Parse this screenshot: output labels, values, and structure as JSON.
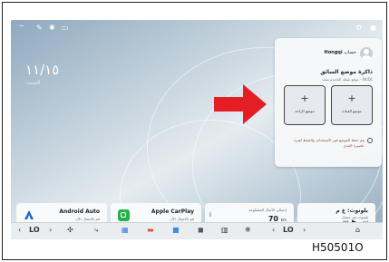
{
  "statusbar": {
    "icons": [
      "wifi-icon",
      "bluetooth-icon",
      "camera-icon",
      "settings-icon"
    ]
  },
  "date": {
    "main": "١١/١٥",
    "sub": "السبت"
  },
  "panel": {
    "account_name": "Hongqi",
    "account_prefix": "حساب",
    "title": "ذاكرة موضع السائق",
    "subtitle": "موقع نقطة القاعدة مقعد - NUDL",
    "slot_right_label": "موضع القيادة",
    "slot_left_label": "موضع الراحة",
    "plus_symbol": "+",
    "notice": "يتم حفظ الموضع فور الاستخدام، والحفظ لفترة قصيرة المدى."
  },
  "cards": {
    "android_title": "Android Auto",
    "android_sub": "قم بالاتصال الآن",
    "carplay_title": "Apple CarPlay",
    "carplay_sub": "قم بالاتصال الآن",
    "trip_title": "إجمالي الأميال المقطوعة",
    "trip_unit": "km",
    "trip_value": "70",
    "bt_title": "بلوتوث: غ م",
    "bt_sub": "بلوتوث غير متصل"
  },
  "nav": {
    "left_temp": "LO",
    "right_temp": "LO",
    "left_arrow": "‹",
    "right_arrow": "›"
  },
  "figure_code": "H50501O",
  "colors": {
    "arrow": "#e31e24",
    "wallpaper": "#a9bdcd"
  }
}
